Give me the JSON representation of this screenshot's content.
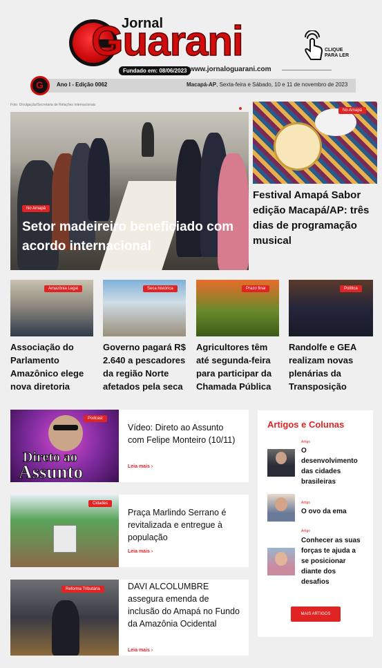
{
  "masthead": {
    "jornal": "Jornal",
    "name": "Guarani",
    "founded": "Fundado em: 08/06/2023",
    "url": "www.jornaloguarani.com",
    "click_to_read": [
      "CLIQUE",
      "PARA LER"
    ]
  },
  "edition": {
    "number": "Ano I - Edição 0062",
    "place": "Macapá-AP",
    "date": ", Sexta-feira e Sábado, 10 e 11 de novembro de 2023"
  },
  "photo_credit": "Foto: Divulgação/Secretaria de Relações Internacionais",
  "lead": {
    "tag": "No Amapá",
    "title": "Setor madeireiro beneficiado com acordo internacional"
  },
  "feature": {
    "tag": "No Amapá",
    "title": "Festival Amapá Sabor edição Macapá/AP: três dias de programação musical"
  },
  "cards": [
    {
      "tag": "Amazônia Legal",
      "title": "Associação do Parlamento Amazônico elege nova diretoria"
    },
    {
      "tag": "Seca histórica",
      "title": "Governo pagará R$ 2.640 a pescadores da região Norte afetados pela seca"
    },
    {
      "tag": "Prazo final",
      "title": "Agricultores têm até segunda-feira para participar da Chamada Pública"
    },
    {
      "tag": "Política",
      "title": "Randolfe e GEA realizam novas plenárias da Transposição"
    }
  ],
  "list": [
    {
      "tag": "Podcast",
      "title": "Vídeo: Direto ao Assunto com Felipe Monteiro (10/11)",
      "read_more": "Leia mais ›",
      "image_text": [
        "Direto ao",
        "Assunto"
      ]
    },
    {
      "tag": "Cidades",
      "title": "Praça Marlindo Serrano é revitalizada e entregue à população",
      "read_more": "Leia mais ›"
    },
    {
      "tag": "Reforma Tributária",
      "title": "DAVI ALCOLUMBRE assegura emenda de inclusão do Amapá no Fundo da Amazônia Ocidental",
      "read_more": "Leia mais ›"
    }
  ],
  "sidebar": {
    "heading": "Artigos e Colunas",
    "items": [
      {
        "category": "Artigo",
        "title": "O desenvolvimento das cidades brasileiras"
      },
      {
        "category": "Artigo",
        "title": "O ovo da ema"
      },
      {
        "category": "Artigo",
        "title": "Conhecer as suas forças te ajuda a se posicionar diante dos desafios"
      }
    ],
    "button": "MAIS ARTIGOS"
  },
  "colors": {
    "accent": "#e02323",
    "brand_red": "#d10c0c",
    "background": "#efefef"
  }
}
